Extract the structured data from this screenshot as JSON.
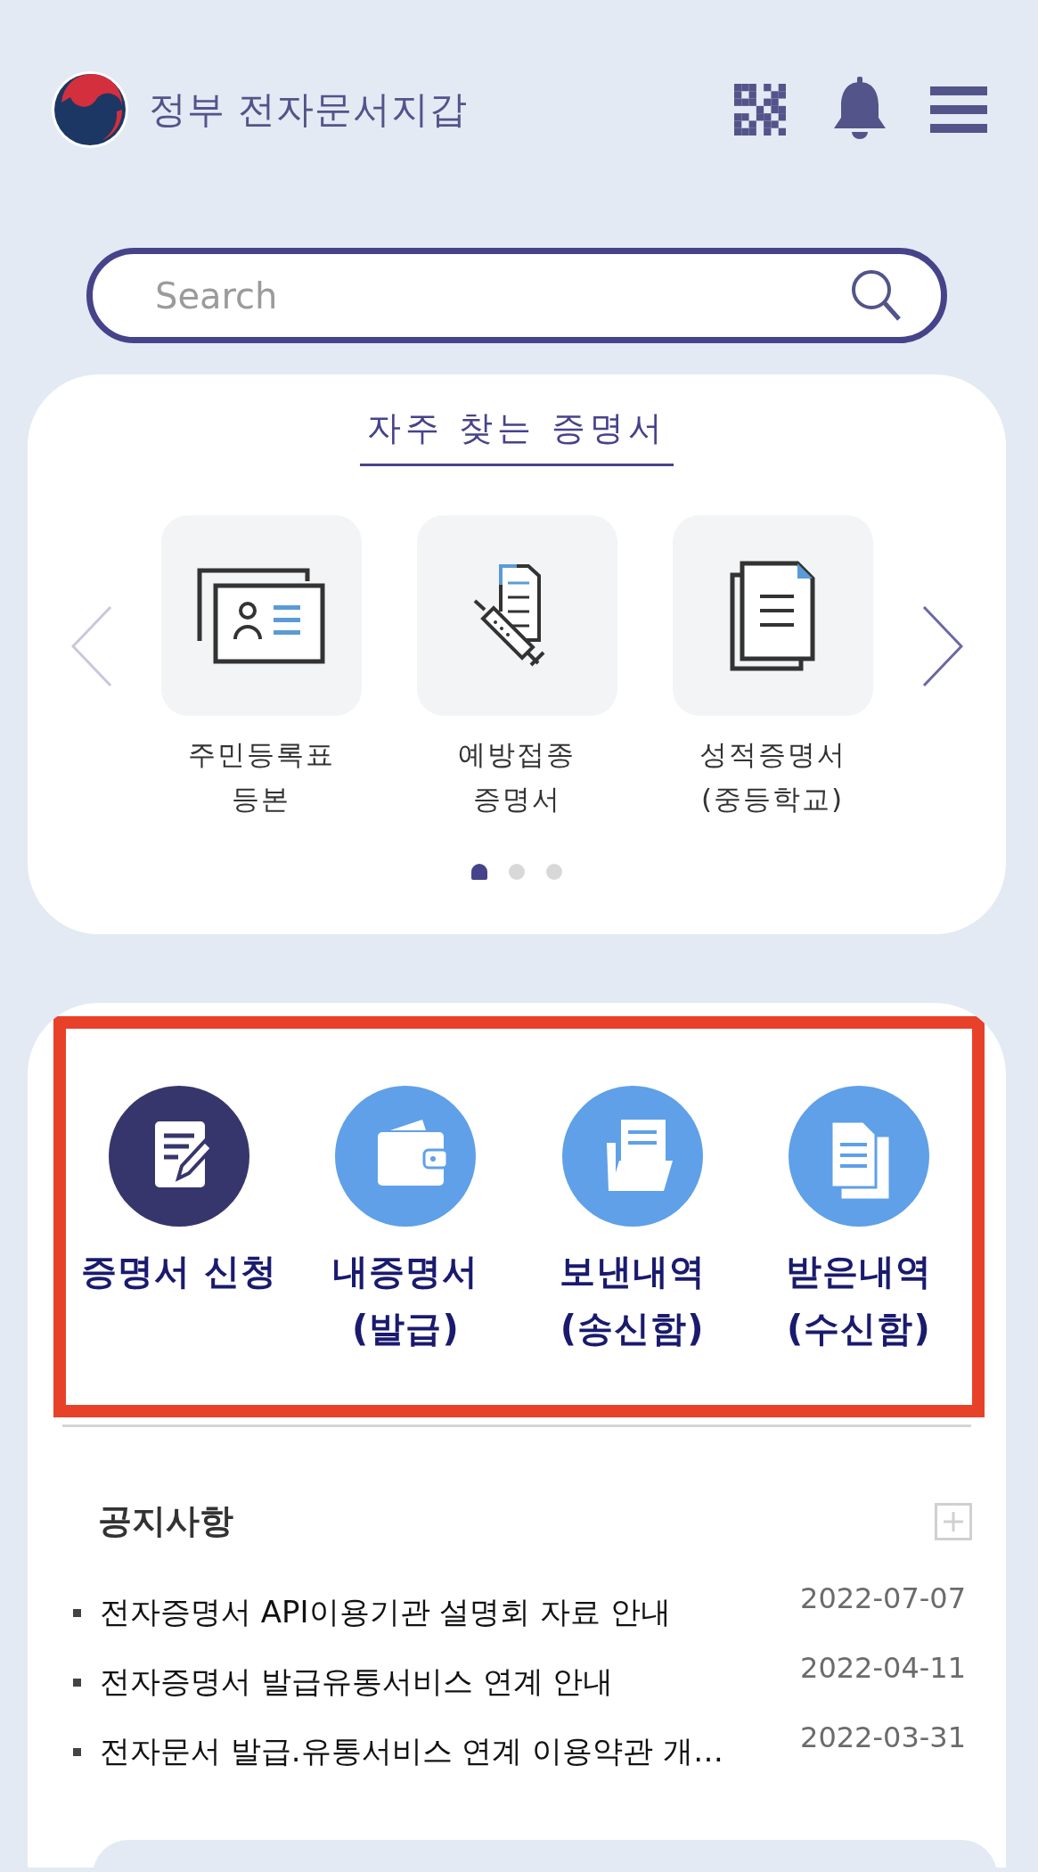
{
  "header": {
    "title": "정부 전자문서지갑"
  },
  "search": {
    "placeholder": "Search"
  },
  "frequent": {
    "title": "자주 찾는 증명서",
    "items": [
      {
        "kind": "id-card",
        "lines": [
          "주민등록표",
          "등본"
        ]
      },
      {
        "kind": "vaccine",
        "lines": [
          "예방접종",
          "증명서"
        ]
      },
      {
        "kind": "documents",
        "lines": [
          "성적증명서",
          "(중등학교)"
        ]
      }
    ],
    "pages": [
      {
        "selected": true
      },
      {
        "selected": false
      },
      {
        "selected": false
      }
    ]
  },
  "shortcuts": {
    "highlighted": true,
    "items": [
      {
        "kind": "apply",
        "selected": true,
        "lines": [
          "증명서 신청"
        ]
      },
      {
        "kind": "wallet",
        "selected": false,
        "lines": [
          "내증명서",
          "(발급)"
        ]
      },
      {
        "kind": "sent",
        "selected": false,
        "lines": [
          "보낸내역",
          "(송신함)"
        ]
      },
      {
        "kind": "received",
        "selected": false,
        "lines": [
          "받은내역",
          "(수신함)"
        ]
      }
    ]
  },
  "notices": {
    "title": "공지사항",
    "items": [
      {
        "title": "전자증명서 API이용기관 설명회 자료 안내",
        "date": "2022-07-07"
      },
      {
        "title": "전자증명서 발급유통서비스 연계 안내",
        "date": "2022-04-11"
      },
      {
        "title": "전자문서 발급.유통서비스 연계 이용약관 개…",
        "date": "2022-03-31"
      }
    ]
  }
}
